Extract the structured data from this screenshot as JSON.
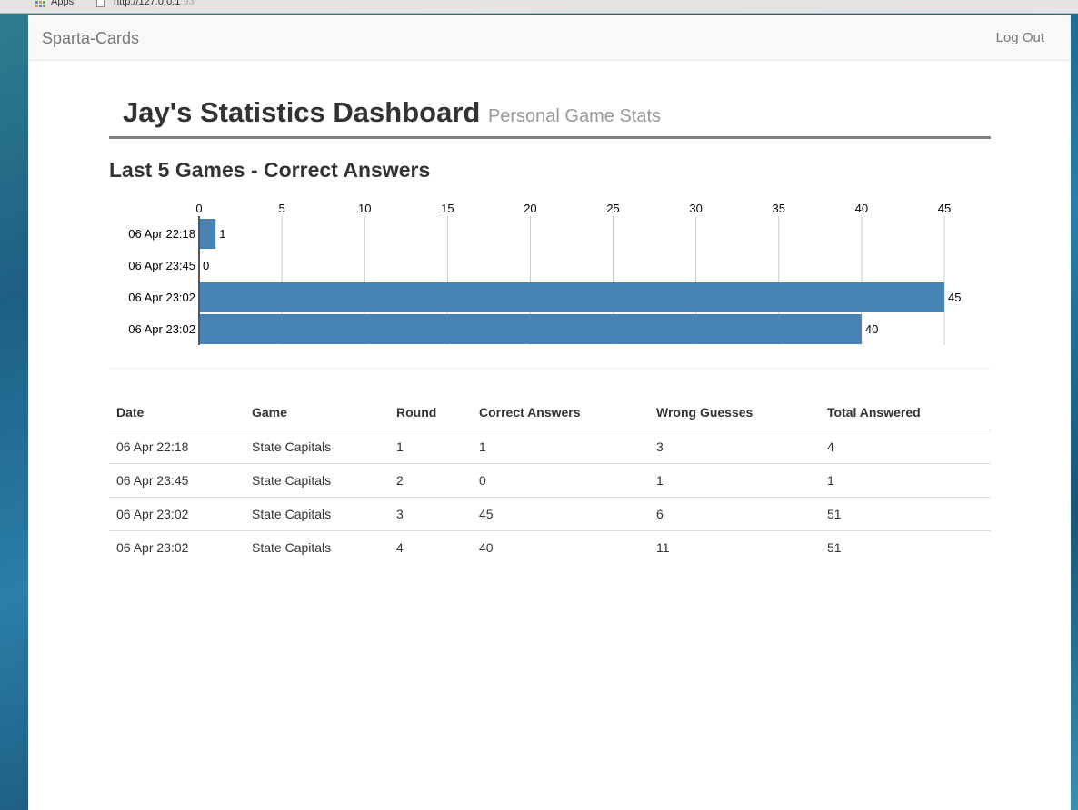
{
  "browser": {
    "apps_label": "Apps",
    "url_main": "http://127.0.0.1",
    "url_rest": ":93"
  },
  "navbar": {
    "brand": "Sparta-Cards",
    "logout": "Log Out"
  },
  "header": {
    "title": "Jay's Statistics Dashboard",
    "subtitle": "Personal Game Stats"
  },
  "chart_section": {
    "title": "Last 5 Games - Correct Answers"
  },
  "chart_data": {
    "type": "bar",
    "orientation": "horizontal",
    "title": "Last 5 Games - Correct Answers",
    "categories": [
      "06 Apr 22:18",
      "06 Apr 23:45",
      "06 Apr 23:02",
      "06 Apr 23:02"
    ],
    "values": [
      1,
      0,
      45,
      40
    ],
    "xlim": [
      0,
      45
    ],
    "ticks": [
      0,
      5,
      10,
      15,
      20,
      25,
      30,
      35,
      40,
      45
    ],
    "bar_color": "#4682b4",
    "grid": true,
    "axis_position": "top"
  },
  "table": {
    "headers": [
      "Date",
      "Game",
      "Round",
      "Correct Answers",
      "Wrong Guesses",
      "Total Answered"
    ],
    "rows": [
      [
        "06 Apr 22:18",
        "State Capitals",
        "1",
        "1",
        "3",
        "4"
      ],
      [
        "06 Apr 23:45",
        "State Capitals",
        "2",
        "0",
        "1",
        "1"
      ],
      [
        "06 Apr 23:02",
        "State Capitals",
        "3",
        "45",
        "6",
        "51"
      ],
      [
        "06 Apr 23:02",
        "State Capitals",
        "4",
        "40",
        "11",
        "51"
      ]
    ]
  }
}
